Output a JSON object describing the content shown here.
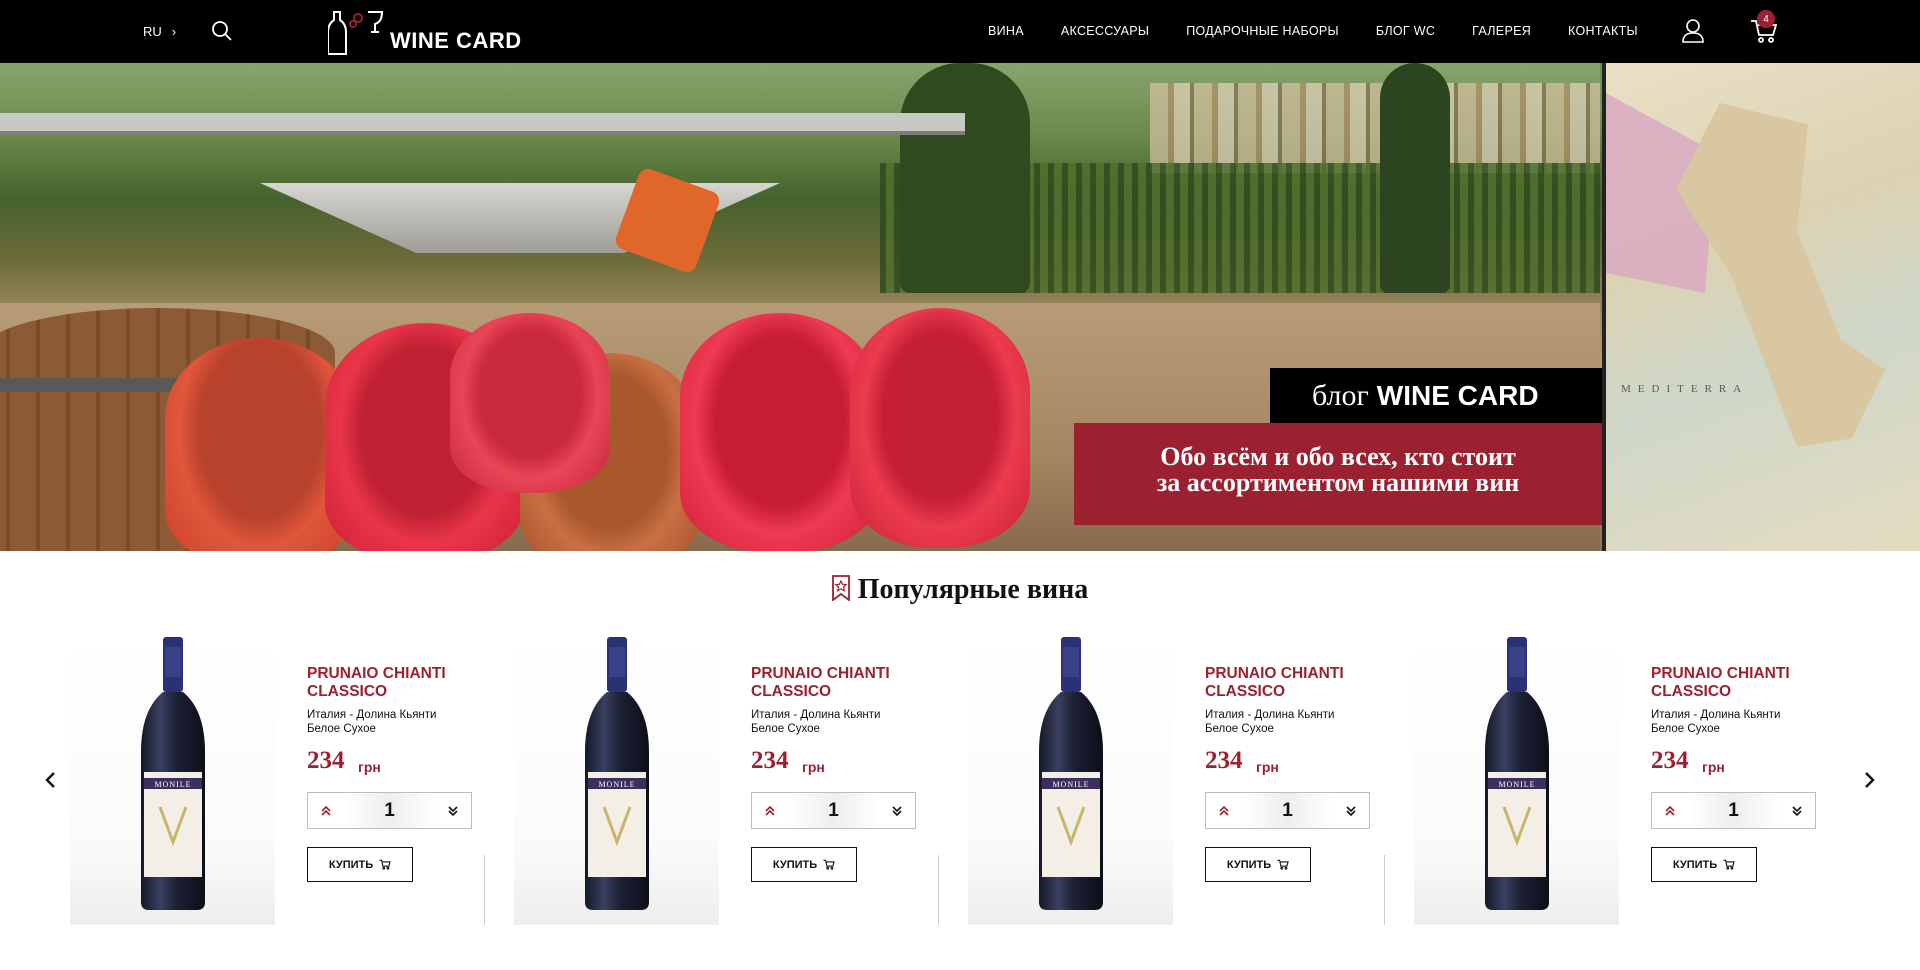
{
  "header": {
    "lang": "RU",
    "logo_text": "WINE CARD",
    "nav": [
      "ВИНА",
      "АКСЕССУАРЫ",
      "ПОДАРОЧНЫЕ НАБОРЫ",
      "БЛОГ WC",
      "ГАЛЕРЕЯ",
      "КОНТАКТЫ"
    ],
    "cart_count": "4",
    "icons": {
      "search": "search-icon",
      "user": "user-icon",
      "cart": "cart-icon"
    }
  },
  "hero": {
    "blog_prefix": "блог",
    "blog_brand": "WINE CARD",
    "banner_line1": "Обо всём и обо всех, кто стоит",
    "banner_line2": "за ассортиментом нашими вин",
    "slides_total": 4,
    "active_slide": 2
  },
  "popular": {
    "title": "Популярные вина",
    "products": [
      {
        "name": "PRUNAIO CHIANTI CLASSICO",
        "region": "Италия - Долина Кьянти",
        "type": "Белое Сухое",
        "price": "234",
        "currency": "грн",
        "qty": "1",
        "buy": "КУПИТЬ",
        "label": "MONILE"
      },
      {
        "name": "PRUNAIO CHIANTI CLASSICO",
        "region": "Италия - Долина Кьянти",
        "type": "Белое Сухое",
        "price": "234",
        "currency": "грн",
        "qty": "1",
        "buy": "КУПИТЬ",
        "label": "MONILE"
      },
      {
        "name": "PRUNAIO CHIANTI CLASSICO",
        "region": "Италия - Долина Кьянти",
        "type": "Белое Сухое",
        "price": "234",
        "currency": "грн",
        "qty": "1",
        "buy": "КУПИТЬ",
        "label": "MONILE"
      },
      {
        "name": "PRUNAIO CHIANTI CLASSICO",
        "region": "Италия - Долина Кьянти",
        "type": "Белое Сухое",
        "price": "234",
        "currency": "грн",
        "qty": "1",
        "buy": "КУПИТЬ",
        "label": "MONILE"
      }
    ]
  },
  "colors": {
    "accent": "#9b2131",
    "header_bg": "#000000",
    "text": "#111111"
  }
}
